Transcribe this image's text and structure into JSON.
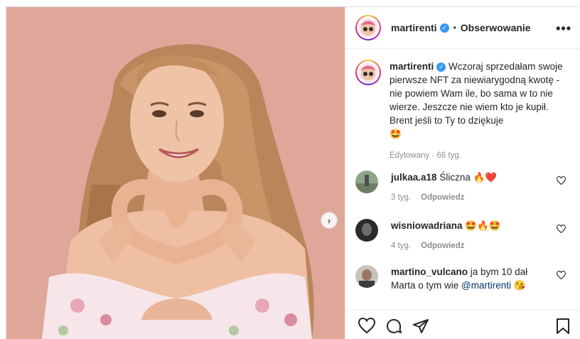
{
  "post": {
    "author": "martirenti",
    "follow_label": "Obserwowanie",
    "more_label": "•••",
    "caption": "Wczoraj sprzedałam swoje pierwsze NFT za niewiarygodną kwotę - nie powiem Wam ile, bo sama w to nie wierze. Jeszcze nie wiem kto je kupił. Brent jeśli to Ty to dziękuje",
    "caption_emoji": "🤩",
    "caption_meta": "Edytowany · 66 tyg."
  },
  "comments": [
    {
      "user": "julkaa.a18",
      "text": "Śliczna",
      "emoji": "🔥❤️",
      "time": "3 tyg.",
      "reply": "Odpowiedz"
    },
    {
      "user": "wisniowadriana",
      "text": "",
      "emoji": "🤩🔥🤩",
      "time": "4 tyg.",
      "reply": "Odpowiedz"
    },
    {
      "user": "martino_vulcano",
      "text": "ja bym 10 dał Marta o tym wie",
      "mention": "@martirenti",
      "emoji": "😘",
      "time": "",
      "reply": ""
    }
  ],
  "icons": {
    "verified": "verified-badge-icon",
    "next": "chevron-right-icon",
    "like": "heart-icon",
    "comment": "comment-icon",
    "share": "paper-plane-icon",
    "save": "bookmark-icon"
  },
  "colors": {
    "verified": "#3897f0",
    "text": "#262626",
    "muted": "#8e8e8e",
    "photo_bg": "#e3aea2"
  }
}
